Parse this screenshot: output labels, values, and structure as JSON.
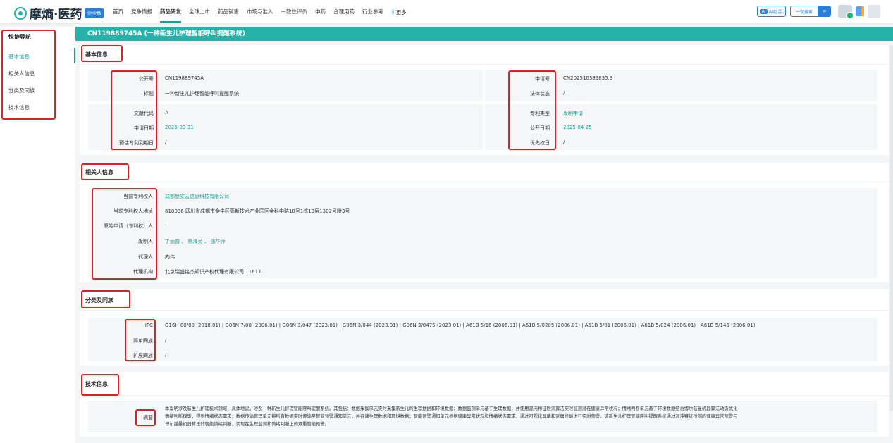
{
  "app": {
    "logo_text": "摩熵·医药",
    "logo_badge": "企业版"
  },
  "nav": {
    "items": [
      "首页",
      "竞争情报",
      "药品研发",
      "全球上市",
      "药品销售",
      "市场与准入",
      "一致性评价",
      "中药",
      "合理用药",
      "行业参考"
    ],
    "more": "更多",
    "ai_label": "AI助手",
    "search_label": "一键搜索"
  },
  "sidebar": {
    "title": "快捷导航",
    "items": [
      "基本信息",
      "相关人信息",
      "分类及同族",
      "技术信息"
    ]
  },
  "page_title": "CN119889745A (一种新生儿护理智能呼叫提醒系统)",
  "basic": {
    "heading": "基本信息",
    "left": [
      {
        "label": "公开号",
        "value": "CN119889745A"
      },
      {
        "label": "标题",
        "value": "一种新生儿护理智能呼叫提醒系统"
      },
      {
        "label": "文献代码",
        "value": "A"
      },
      {
        "label": "申请日期",
        "value": "2025-03-31"
      },
      {
        "label": "预估专利到期日",
        "value": "/"
      }
    ],
    "right": [
      {
        "label": "申请号",
        "value": "CN202510389835.9"
      },
      {
        "label": "法律状态",
        "value": "/"
      },
      {
        "label": "专利类型",
        "value": "发明申请"
      },
      {
        "label": "公开日期",
        "value": "2025-04-25"
      },
      {
        "label": "优先权日",
        "value": "/"
      }
    ]
  },
  "related": {
    "heading": "相关人信息",
    "rows": [
      {
        "label": "当前专利权人",
        "value": "成都慧安云信息科技有限公司"
      },
      {
        "label": "当前专利权人地址",
        "value": "610036 四川省成都市金牛区高新技术产业园区金科中路18号1栋13层1302号附3号"
      },
      {
        "label": "原始申请（专利权）人",
        "value": "-"
      },
      {
        "label": "发明人",
        "value": "丁丽霞 、 杨海英 、 张华萍"
      },
      {
        "label": "代理人",
        "value": "向伟"
      },
      {
        "label": "代理机构",
        "value": "北京瑞盛铭杰知识产权代理有限公司 11617"
      }
    ]
  },
  "classification": {
    "heading": "分类及同族",
    "rows": [
      {
        "label": "IPC",
        "value": "G16H 80/00 (2018.01) | G06N 7/08 (2006.01) | G06N 3/047 (2023.01) | G06N 3/044 (2023.01) | G06N 3/0475 (2023.01) | A61B 5/16 (2006.01) | A61B 5/0205 (2006.01) | A61B 5/01 (2006.01) | A61B 5/024 (2006.01) | A61B 5/145 (2006.01)"
      },
      {
        "label": "简单同族",
        "value": "/"
      },
      {
        "label": "扩展同族",
        "value": "/"
      }
    ]
  },
  "tech": {
    "heading": "技术信息",
    "label": "摘要",
    "lines": [
      "本发明涉及新生儿护理技术领域，具体地说，涉及一种新生儿护理智能呼叫提醒系统。其包括：数据采集单元实时采集新生儿的生理数据和环境数据；数据监测单元基于生理数据，并使用混沌特征检测算法实时监测潜在健康异常状况；情绪判断单元基于环境数据结合博尔兹曼机器算法动态优化",
      "情绪判断模型，得到情绪状态需求；数据传输管理单元将所有数据实时传输至智能预警通知单元，并存储生理数据和环境数据；智能预警通知单元根据健康异常状况和情绪状态需求，通过可视化屏幕和家属终端进行实时预警。该新生儿护理智能呼叫提醒系统通过混沌特征检测的健康异常预警与",
      "博尔兹曼机器算法的智能情绪判断，实现在生理监测和情绪判断上的双重智能预警。"
    ]
  }
}
